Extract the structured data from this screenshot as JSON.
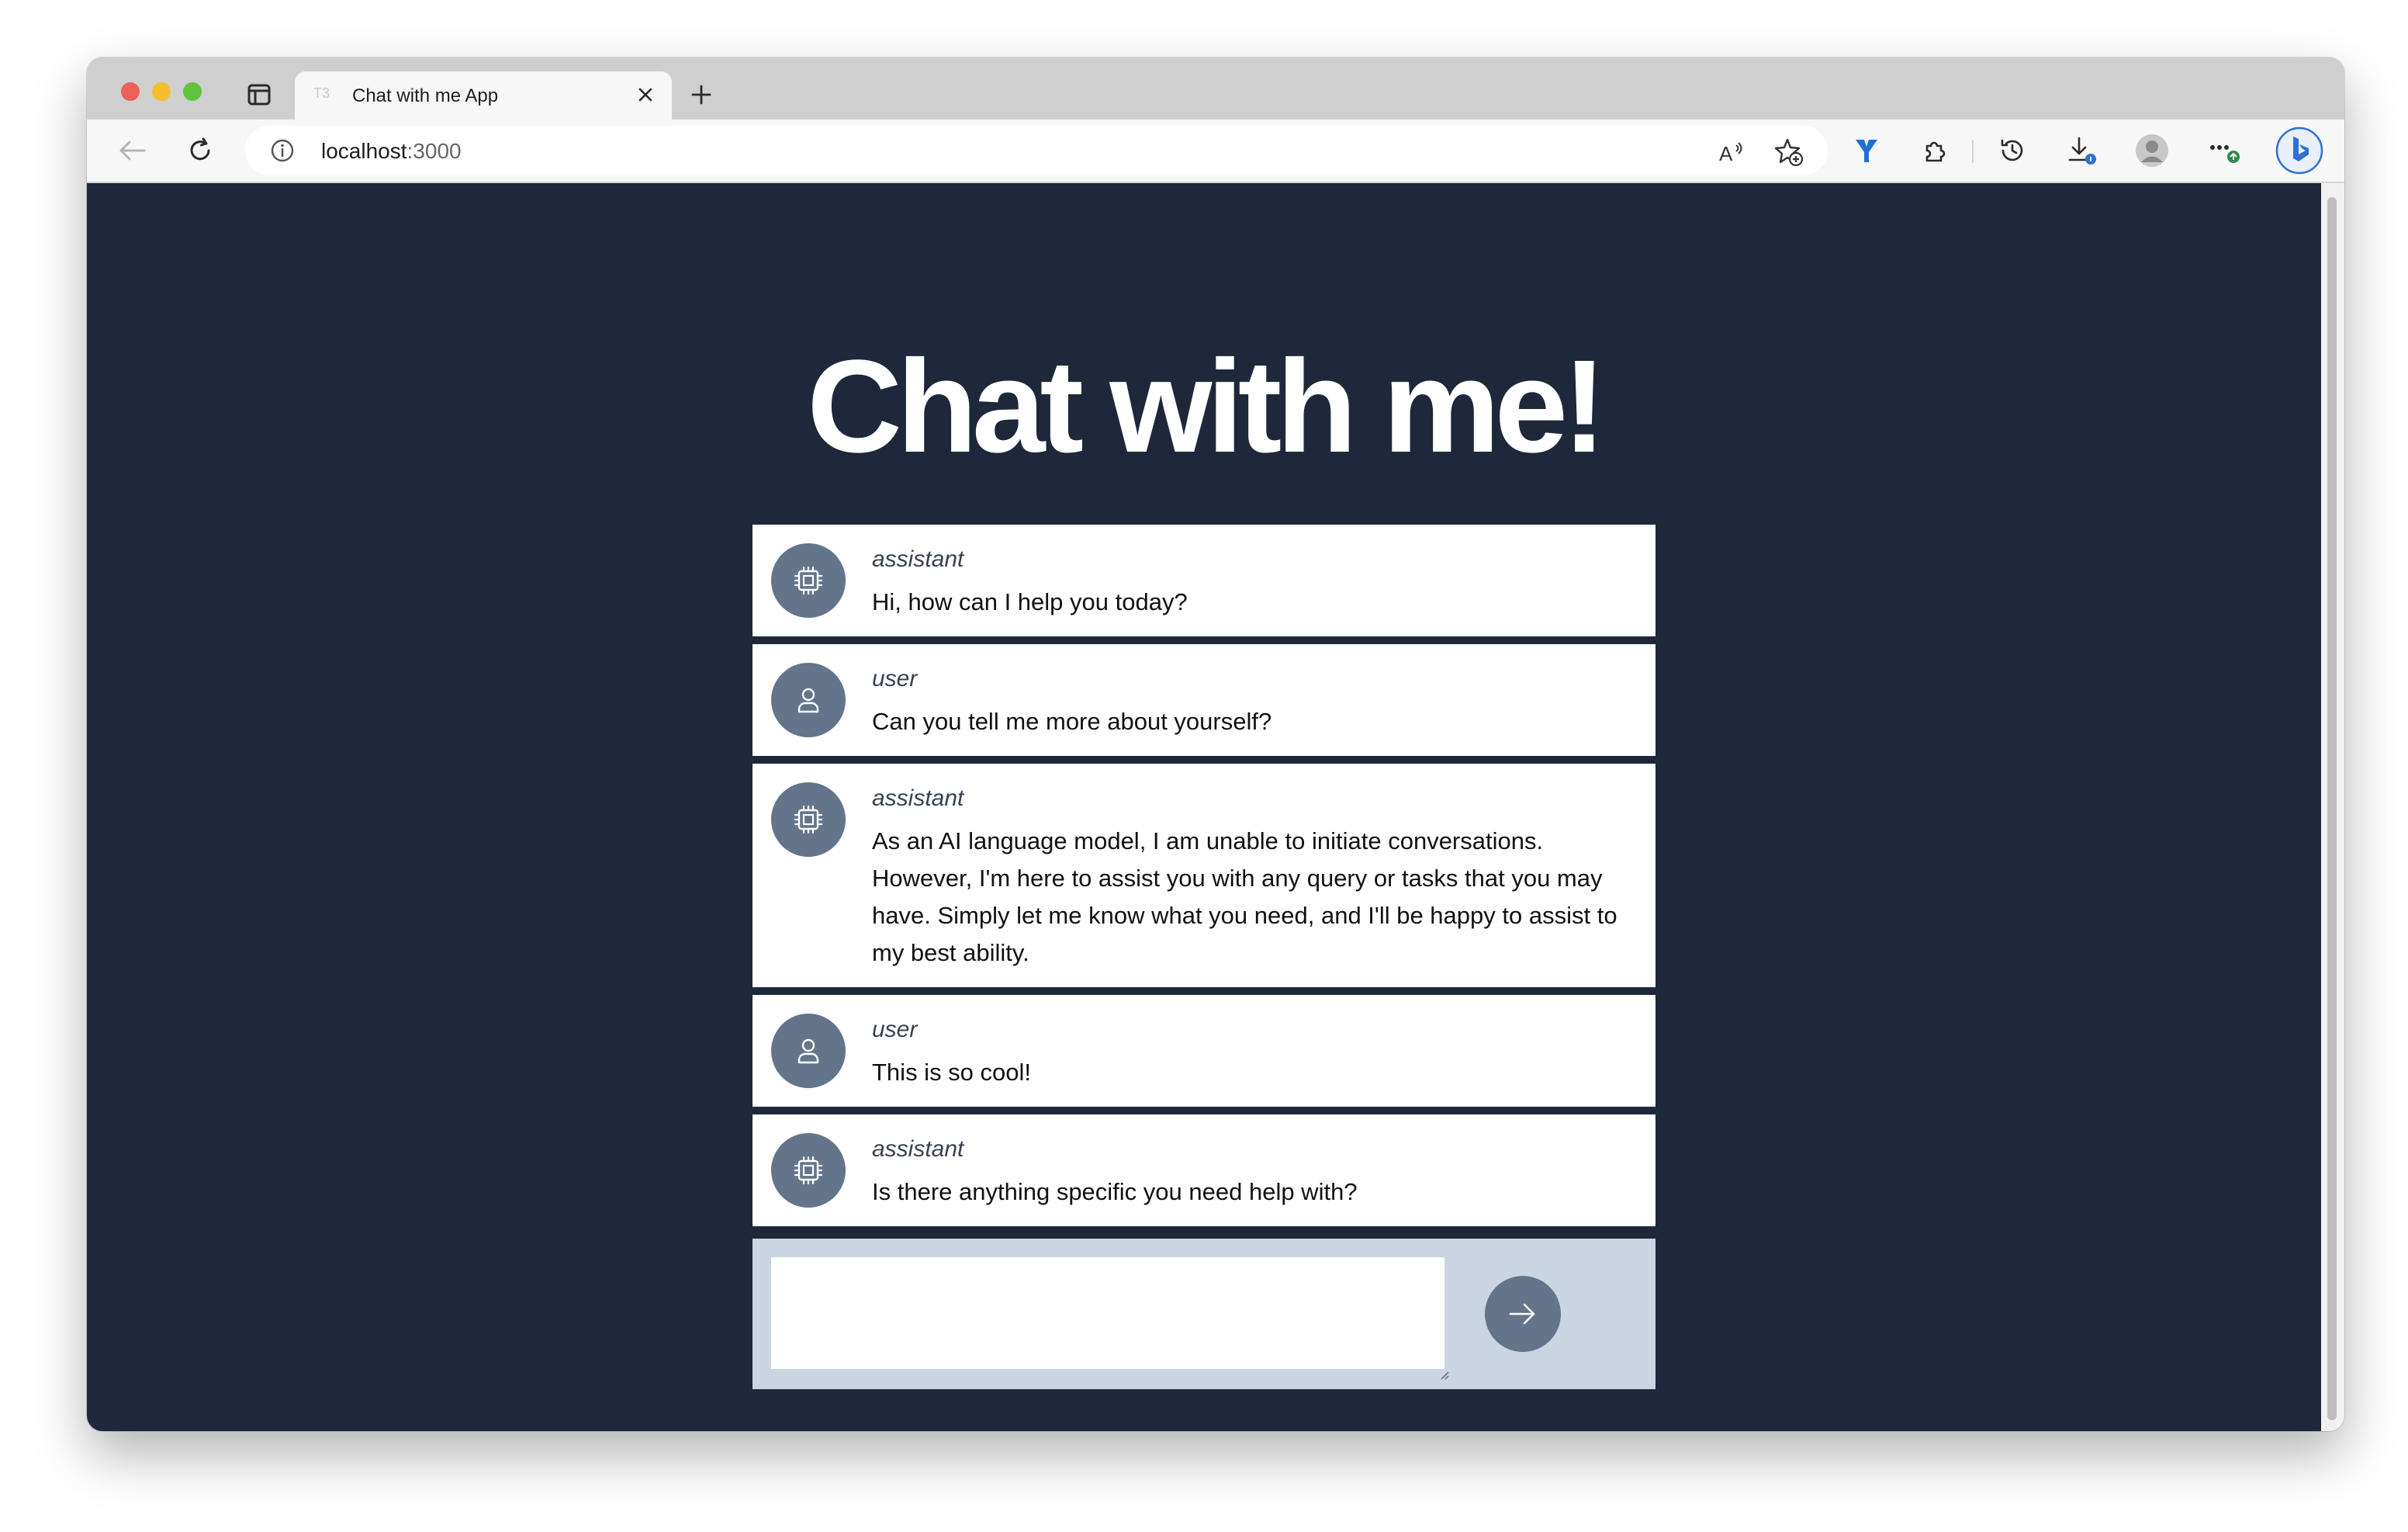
{
  "browser": {
    "tab_title": "Chat with me App",
    "tab_favicon": "T3",
    "url_host": "localhost",
    "url_port": ":3000",
    "icons": [
      "tab-actions-icon",
      "close-icon",
      "plus-icon",
      "back-arrow-icon",
      "reload-icon",
      "info-icon",
      "read-aloud-icon",
      "favorite-add-icon",
      "extension-y-icon",
      "puzzle-icon",
      "history-icon",
      "download-icon",
      "profile-avatar-icon",
      "more-icon",
      "bing-icon"
    ]
  },
  "page": {
    "title": "Chat with me!",
    "messages": [
      {
        "role": "assistant",
        "text": "Hi, how can I help you today?",
        "icon": "chip-icon"
      },
      {
        "role": "user",
        "text": "Can you tell me more about yourself?",
        "icon": "user-icon"
      },
      {
        "role": "assistant",
        "text": "As an AI language model, I am unable to initiate conversations. However, I'm here to assist you with any query or tasks that you may have. Simply let me know what you need, and I'll be happy to assist to my best ability.",
        "icon": "chip-icon"
      },
      {
        "role": "user",
        "text": "This is so cool!",
        "icon": "user-icon"
      },
      {
        "role": "assistant",
        "text": "Is there anything specific you need help with?",
        "icon": "chip-icon"
      }
    ],
    "composer": {
      "value": "",
      "send_icon": "arrow-right-icon"
    }
  },
  "colors": {
    "page_bg": "#1f283a",
    "avatar_bg": "#64748b",
    "composer_bg": "#cbd5e1",
    "message_bg": "#ffffff"
  }
}
